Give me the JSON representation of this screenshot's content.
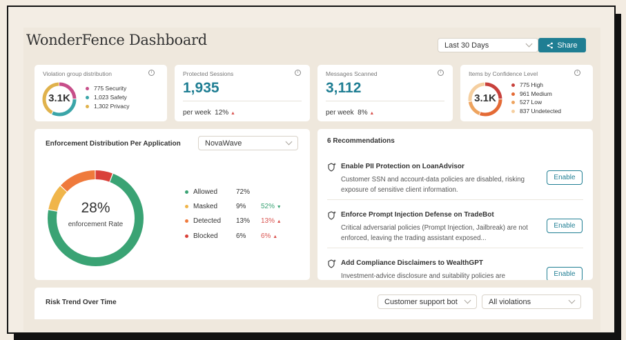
{
  "header": {
    "title": "WonderFence Dashboard",
    "date_range": "Last 30 Days",
    "share_label": "Share"
  },
  "colors": {
    "accent": "#1f7e93",
    "security": "#c74f8a",
    "safety": "#3aa5a8",
    "privacy": "#e0b24c",
    "high": "#c8413c",
    "medium": "#e46a35",
    "low": "#eea45f",
    "undetected": "#f5cfa0",
    "allowed": "#3aa374",
    "masked": "#f0b54a",
    "detected": "#ef7a3c",
    "blocked": "#d9413a"
  },
  "violations": {
    "label": "Violation group distribution",
    "total": "3.1K",
    "items": [
      {
        "label": "775 Security",
        "value": 775
      },
      {
        "label": "1,023 Safety",
        "value": 1023
      },
      {
        "label": "1,302 Privacy",
        "value": 1302
      }
    ]
  },
  "sessions": {
    "label": "Protected Sessions",
    "value": "1,935",
    "period": "per week",
    "change": "12%"
  },
  "messages": {
    "label": "Messages Scanned",
    "value": "3,112",
    "period": "per week",
    "change": "8%"
  },
  "confidence": {
    "label": "Items by Confidence Level",
    "total": "3.1K",
    "items": [
      {
        "label": "775 High",
        "value": 775
      },
      {
        "label": "961 Medium",
        "value": 961
      },
      {
        "label": "527 Low",
        "value": 527
      },
      {
        "label": "837 Undetected",
        "value": 837
      }
    ]
  },
  "enforcement": {
    "title": "Enforcement Distribution Per Application",
    "app": "NovaWave",
    "rate": "28%",
    "rate_label": "enforcement Rate",
    "rows": [
      {
        "name": "Allowed",
        "pct": "72%",
        "change": "",
        "value": 72
      },
      {
        "name": "Masked",
        "pct": "9%",
        "change": "52%",
        "value": 9
      },
      {
        "name": "Detected",
        "pct": "13%",
        "change": "13%",
        "value": 13
      },
      {
        "name": "Blocked",
        "pct": "6%",
        "change": "6%",
        "value": 6
      }
    ]
  },
  "recommendations": {
    "title": "6 Recommendations",
    "items": [
      {
        "title": "Enable PII Protection on LoanAdvisor",
        "desc": "Customer SSN and account-data policies are disabled, risking exposure of sensitive client information.",
        "action": "Enable"
      },
      {
        "title": "Enforce Prompt Injection Defense on TradeBot",
        "desc": "Critical adversarial policies (Prompt Injection, Jailbreak) are not enforced, leaving the trading assistant exposed...",
        "action": "Enable"
      },
      {
        "title": "Add Compliance Disclaimers to WealthGPT",
        "desc": "Investment-advice disclosure and suitability policies are",
        "action": "Enable"
      }
    ]
  },
  "risk": {
    "title": "Risk Trend Over Time",
    "bot_filter": "Customer support bot",
    "violation_filter": "All violations"
  }
}
